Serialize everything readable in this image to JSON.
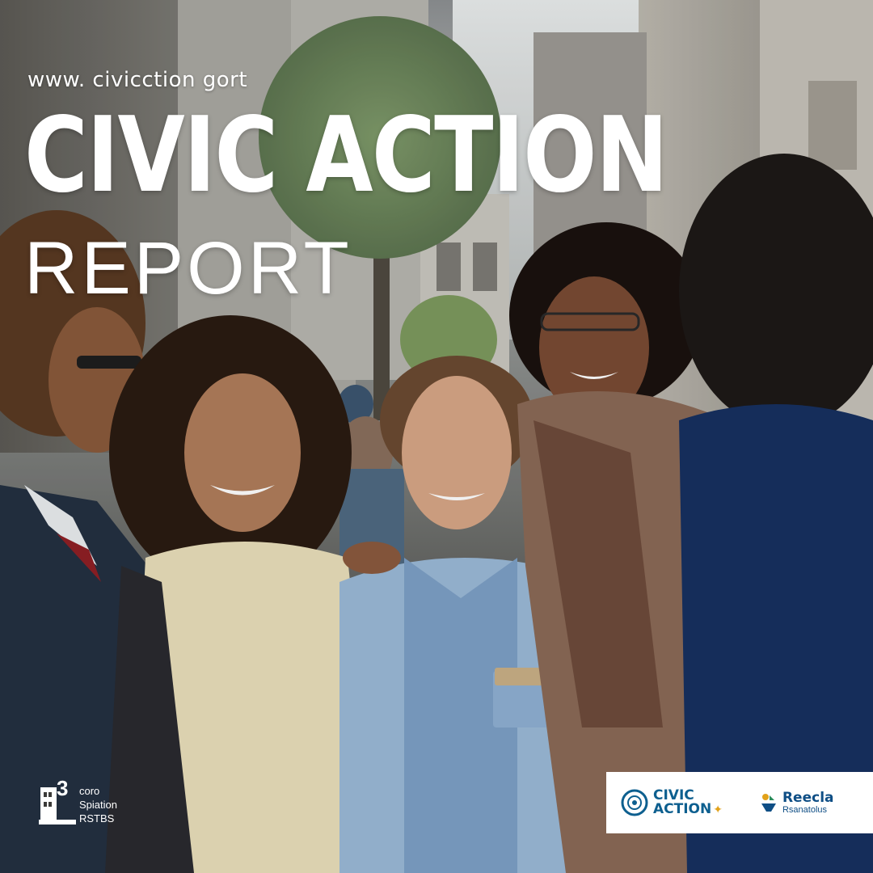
{
  "poster": {
    "url": "www. civicction gort",
    "title": "CIVIC ACTION",
    "subtitle": "REPORT"
  },
  "logo_left": {
    "number": "3",
    "line1": "coro",
    "line2": "Spiation",
    "line3": "RSTBS"
  },
  "partners": {
    "civic_line1": "CIVIC",
    "civic_line2": "ACTION",
    "partner_name": "Reecla",
    "partner_sub": "Rsanatolus"
  },
  "colors": {
    "title_text": "#ffffff",
    "partner_bar_bg": "#ffffff",
    "civic_blue": "#0d5f8f",
    "accent_gold": "#e2a21a"
  }
}
